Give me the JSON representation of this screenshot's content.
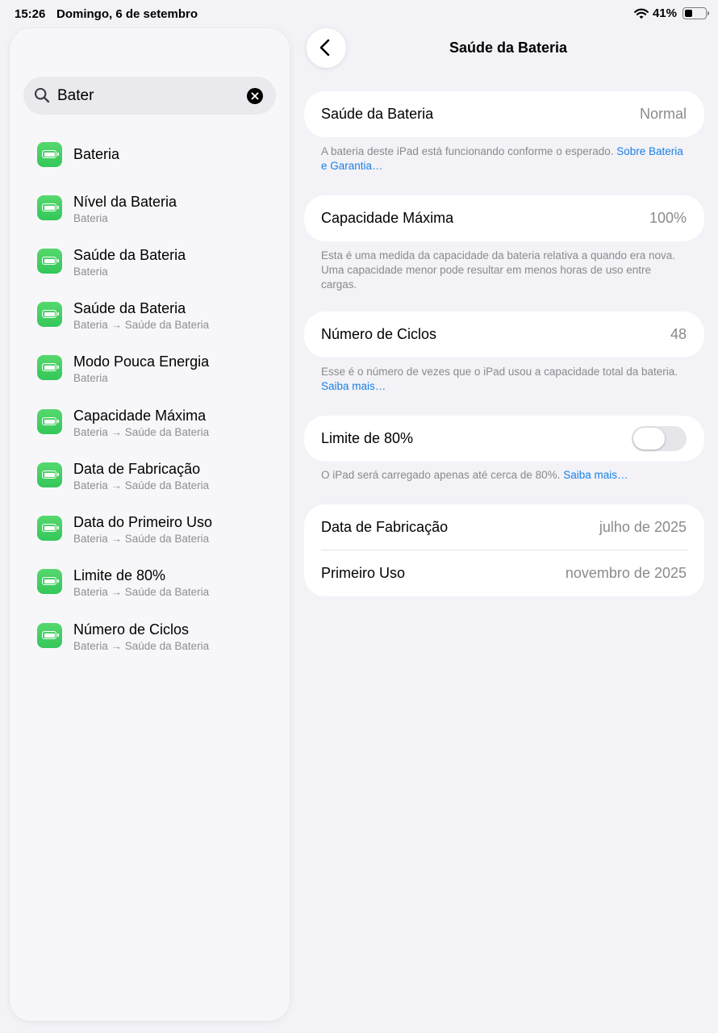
{
  "status_bar": {
    "time": "15:26",
    "date": "Domingo, 6 de setembro",
    "battery_percent": "41%",
    "battery_level": 0.41,
    "wifi_icon": "wifi-icon",
    "battery_icon": "battery-icon"
  },
  "sidebar": {
    "search": {
      "value": "Bater",
      "search_icon": "magnifying-glass-icon",
      "clear_icon": "xmark-circle-fill-icon"
    },
    "results": [
      {
        "title": "Bateria",
        "subtitle": ""
      },
      {
        "title": "Nível da Bateria",
        "subtitle": "Bateria"
      },
      {
        "title": "Saúde da Bateria",
        "subtitle": "Bateria"
      },
      {
        "title": "Saúde da Bateria",
        "subtitle": "Bateria → Saúde da Bateria"
      },
      {
        "title": "Modo Pouca Energia",
        "subtitle": "Bateria"
      },
      {
        "title": "Capacidade Máxima",
        "subtitle": "Bateria → Saúde da Bateria"
      },
      {
        "title": "Data de Fabricação",
        "subtitle": "Bateria → Saúde da Bateria"
      },
      {
        "title": "Data do Primeiro Uso",
        "subtitle": "Bateria → Saúde da Bateria"
      },
      {
        "title": "Limite de 80%",
        "subtitle": "Bateria → Saúde da Bateria"
      },
      {
        "title": "Número de Ciclos",
        "subtitle": "Bateria → Saúde da Bateria"
      }
    ],
    "result_icon": "battery-app-icon",
    "icon_color": "#34c759"
  },
  "main": {
    "back_icon": "chevron-left-icon",
    "title": "Saúde da Bateria",
    "health": {
      "label": "Saúde da Bateria",
      "value": "Normal",
      "footer_text": "A bateria deste iPad está funcionando conforme o esperado. ",
      "footer_link": "Sobre Bateria e Garantia…"
    },
    "capacity": {
      "label": "Capacidade Máxima",
      "value": "100%",
      "footer_text": "Esta é uma medida da capacidade da bateria relativa a quando era nova. Uma capacidade menor pode resultar em menos horas de uso entre cargas."
    },
    "cycles": {
      "label": "Número de Ciclos",
      "value": "48",
      "footer_text": "Esse é o número de vezes que o iPad usou a capacidade total da bateria. ",
      "footer_link": "Saiba mais…"
    },
    "limit": {
      "label": "Limite de 80%",
      "toggle_on": false,
      "footer_text": "O iPad será carregado apenas até cerca de 80%. ",
      "footer_link": "Saiba mais…"
    },
    "dates": {
      "manufacture_label": "Data de Fabricação",
      "manufacture_value": "julho de 2025",
      "first_use_label": "Primeiro Uso",
      "first_use_value": "novembro de 2025"
    },
    "link_color": "#1a80e5"
  }
}
